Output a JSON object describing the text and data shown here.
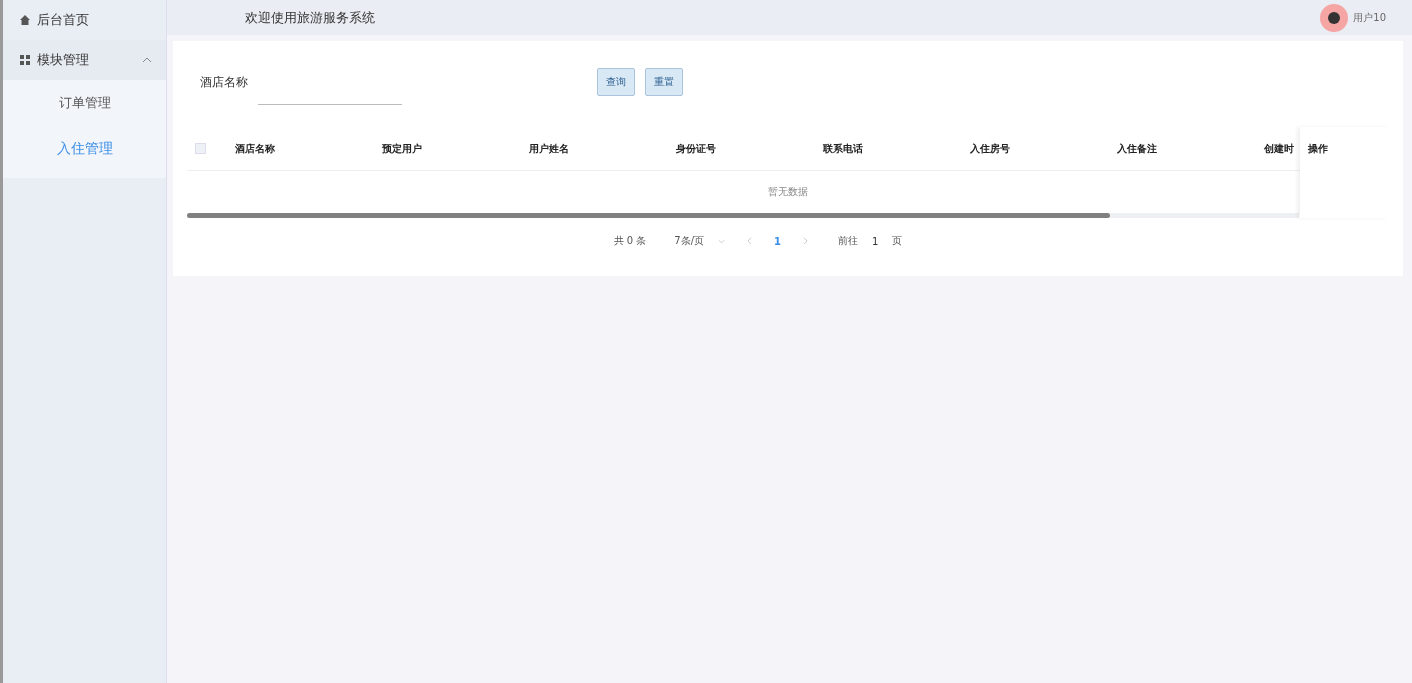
{
  "sidebar": {
    "items": [
      {
        "label": "后台首页",
        "kind": "link"
      },
      {
        "label": "模块管理",
        "kind": "group",
        "expanded": true,
        "children": [
          {
            "label": "订单管理",
            "selected": false
          },
          {
            "label": "入住管理",
            "selected": true
          }
        ]
      }
    ]
  },
  "header": {
    "title": "欢迎使用旅游服务系统",
    "user": "用户10"
  },
  "search": {
    "label": "酒店名称",
    "buttons": [
      "查询",
      "重置"
    ]
  },
  "table": {
    "columns": [
      "酒店名称",
      "预定用户",
      "用户姓名",
      "身份证号",
      "联系电话",
      "入住房号",
      "入住备注",
      "创建时"
    ],
    "fixed_column": "操作",
    "empty_text": "暂无数据",
    "select_all_checked": false
  },
  "pagination": {
    "total": "共 0 条",
    "page_size": "7条/页",
    "pages": [
      {
        "label": "1",
        "selected": true
      }
    ],
    "goto_label": "前往",
    "goto_value": "1",
    "goto_suffix": "页"
  }
}
